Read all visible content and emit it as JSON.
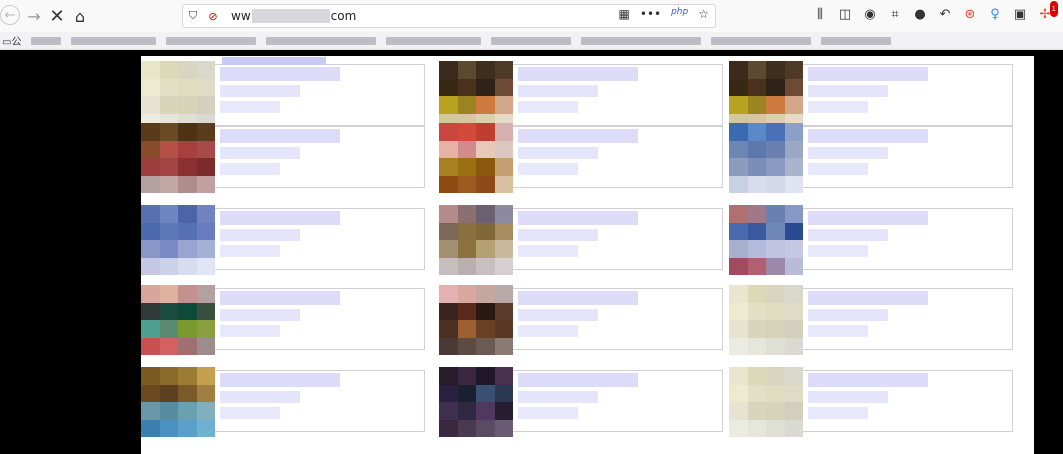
{
  "toolbar": {
    "back_icon": "arrow-left-icon",
    "forward_icon": "arrow-right-icon",
    "stop_icon": "close-icon",
    "home_icon": "home-icon"
  },
  "urlbar": {
    "prefix": "ww",
    "suffix": "com",
    "php_label": "php",
    "dots": "•••"
  },
  "bookmarks": {
    "first_label": "公"
  },
  "colors": {
    "accent": "#3b5bdb",
    "placeholder": "#dcdcf8"
  },
  "cards": [
    {
      "row": 0,
      "col": 0,
      "palette": [
        "#e8e6c8",
        "#dcd9b8",
        "#d8d6c0",
        "#d8d8cc",
        "#ecebd0",
        "#e2e0c4",
        "#dfddc0",
        "#dedcc6",
        "#e6e4d0",
        "#d8d5bb",
        "#d6d3b8",
        "#d2d0bc",
        "#ecebe0",
        "#e7e6dc",
        "#e0dfd6",
        "#dbdad2"
      ]
    },
    {
      "row": 0,
      "col": 1,
      "palette": [
        "#3c2a1d",
        "#5b4a30",
        "#3f2e1e",
        "#4f3a28",
        "#3a2816",
        "#4a321c",
        "#2f2217",
        "#6c4a35",
        "#b9a220",
        "#9c8420",
        "#cf7a3e",
        "#d3a78a",
        "#d2c89c",
        "#d7c7a0",
        "#dccfb0",
        "#e6dbc9"
      ]
    },
    {
      "row": 0,
      "col": 2,
      "palette": [
        "#3c2a1d",
        "#5b4a30",
        "#3f2e1e",
        "#4f3a28",
        "#3a2816",
        "#4a321c",
        "#2f2217",
        "#6c4a35",
        "#b9a220",
        "#9c8420",
        "#cf7a3e",
        "#d3a78a",
        "#d2c89c",
        "#d7c7a0",
        "#dccfb0",
        "#e6dbc9"
      ]
    },
    {
      "row": 1,
      "col": 0,
      "palette": [
        "#5a3a1a",
        "#6a4a22",
        "#4e3214",
        "#5a3c1c",
        "#8a4b2a",
        "#b45045",
        "#a94040",
        "#a84a4a",
        "#9c3c3c",
        "#a04444",
        "#8b3030",
        "#7a2c2c",
        "#b4a0a0",
        "#c4a8a8",
        "#b08c8c",
        "#c0a0a0"
      ]
    },
    {
      "row": 1,
      "col": 1,
      "palette": [
        "#c8463e",
        "#d24a3a",
        "#c03e30",
        "#d6b0b0",
        "#e7b2a4",
        "#d08c8c",
        "#e8c8b8",
        "#dec7c0",
        "#a88020",
        "#9c7010",
        "#8c5810",
        "#c4a070",
        "#8a4a10",
        "#9a5a20",
        "#8c4a18",
        "#d8c0a0"
      ]
    },
    {
      "row": 1,
      "col": 2,
      "palette": [
        "#3a6ab0",
        "#5a88c8",
        "#4a70b8",
        "#8aa0c8",
        "#6e86b4",
        "#5c78ac",
        "#6a80b0",
        "#9aa8c4",
        "#8c9cbc",
        "#7a8eb8",
        "#8a9ac0",
        "#a8b4cc",
        "#c8d0e4",
        "#d8dcec",
        "#d4d8e8",
        "#e0e4f0"
      ]
    },
    {
      "row": 2,
      "col": 0,
      "palette": [
        "#5a70b0",
        "#6e86c0",
        "#4e64a8",
        "#7282c0",
        "#4c68ac",
        "#5e78b8",
        "#5870b4",
        "#6a7cc0",
        "#8896c8",
        "#7a8ac4",
        "#9aa4d0",
        "#a4b0d6",
        "#c4c8e4",
        "#ccd2ea",
        "#d8dcf0",
        "#e0e4f4"
      ]
    },
    {
      "row": 2,
      "col": 1,
      "palette": [
        "#b48a8a",
        "#8a7070",
        "#6c6070",
        "#8a8aa0",
        "#7c6858",
        "#8a7040",
        "#806838",
        "#a88c60",
        "#a09070",
        "#8c7040",
        "#b4a070",
        "#c8b89c",
        "#c4bebe",
        "#b8b0b0",
        "#c8c0c0",
        "#d8d0d0"
      ]
    },
    {
      "row": 2,
      "col": 2,
      "palette": [
        "#b07070",
        "#a07888",
        "#6a80b0",
        "#8898c4",
        "#4a6ab0",
        "#3a5aa0",
        "#7088b8",
        "#2a4a90",
        "#a8b0d0",
        "#b4bcdc",
        "#c0c4e0",
        "#c4c8e4",
        "#a44a60",
        "#b06070",
        "#9c88a8",
        "#b8bcd8"
      ]
    },
    {
      "row": 3,
      "col": 0,
      "palette": [
        "#d8a49c",
        "#e0b0a0",
        "#c49090",
        "#b4a0a0",
        "#303838",
        "#1a4a40",
        "#0e4a3a",
        "#385040",
        "#50a090",
        "#5a8a70",
        "#7a9a30",
        "#8aa040",
        "#c85050",
        "#d46060",
        "#a07070",
        "#9c8c8c"
      ]
    },
    {
      "row": 3,
      "col": 1,
      "palette": [
        "#e4b0b0",
        "#d8a8a0",
        "#c4a8a0",
        "#b8a8a8",
        "#3a2420",
        "#5a2a1c",
        "#2a1814",
        "#5a3a2a",
        "#4c3024",
        "#9c6030",
        "#6a4024",
        "#5a3826",
        "#4a3a36",
        "#5c4a44",
        "#6a5a54",
        "#8a7a74"
      ]
    },
    {
      "row": 3,
      "col": 2,
      "palette": [
        "#e8e6cc",
        "#dcd9b8",
        "#d8d6c0",
        "#d8d8cc",
        "#ecebd0",
        "#e2e0c4",
        "#dfddc0",
        "#dedcc6",
        "#e6e4d0",
        "#d8d5bb",
        "#d6d3b8",
        "#d2d0bc",
        "#ecebe0",
        "#e7e6dc",
        "#e0dfd6",
        "#dbdad2"
      ]
    },
    {
      "row": 4,
      "col": 0,
      "palette": [
        "#7a5a22",
        "#8a6a2a",
        "#9c7c34",
        "#c4a050",
        "#6a4a20",
        "#5c4020",
        "#7a5a28",
        "#a08040",
        "#6a98a8",
        "#5a8ca0",
        "#6aa0b0",
        "#80b0c0",
        "#3a80b0",
        "#4a90c0",
        "#5aa0c8",
        "#70b0d0"
      ]
    },
    {
      "row": 4,
      "col": 1,
      "palette": [
        "#281c2a",
        "#3a2840",
        "#20182a",
        "#4a3050",
        "#2a2040",
        "#1a2030",
        "#3a5070",
        "#2a3850",
        "#403050",
        "#302840",
        "#503860",
        "#281c30",
        "#3a2840",
        "#4a3a50",
        "#5a4a64",
        "#6a5a74"
      ]
    },
    {
      "row": 4,
      "col": 2,
      "palette": [
        "#e8e6cc",
        "#dcd9b8",
        "#d8d6c0",
        "#d8d8cc",
        "#ecebd0",
        "#e2e0c4",
        "#dfddc0",
        "#dedcc6",
        "#e6e4d0",
        "#d8d5bb",
        "#d6d3b8",
        "#d2d0bc",
        "#ecebe0",
        "#e7e6dc",
        "#e0dfd6",
        "#dbdad2"
      ]
    }
  ]
}
